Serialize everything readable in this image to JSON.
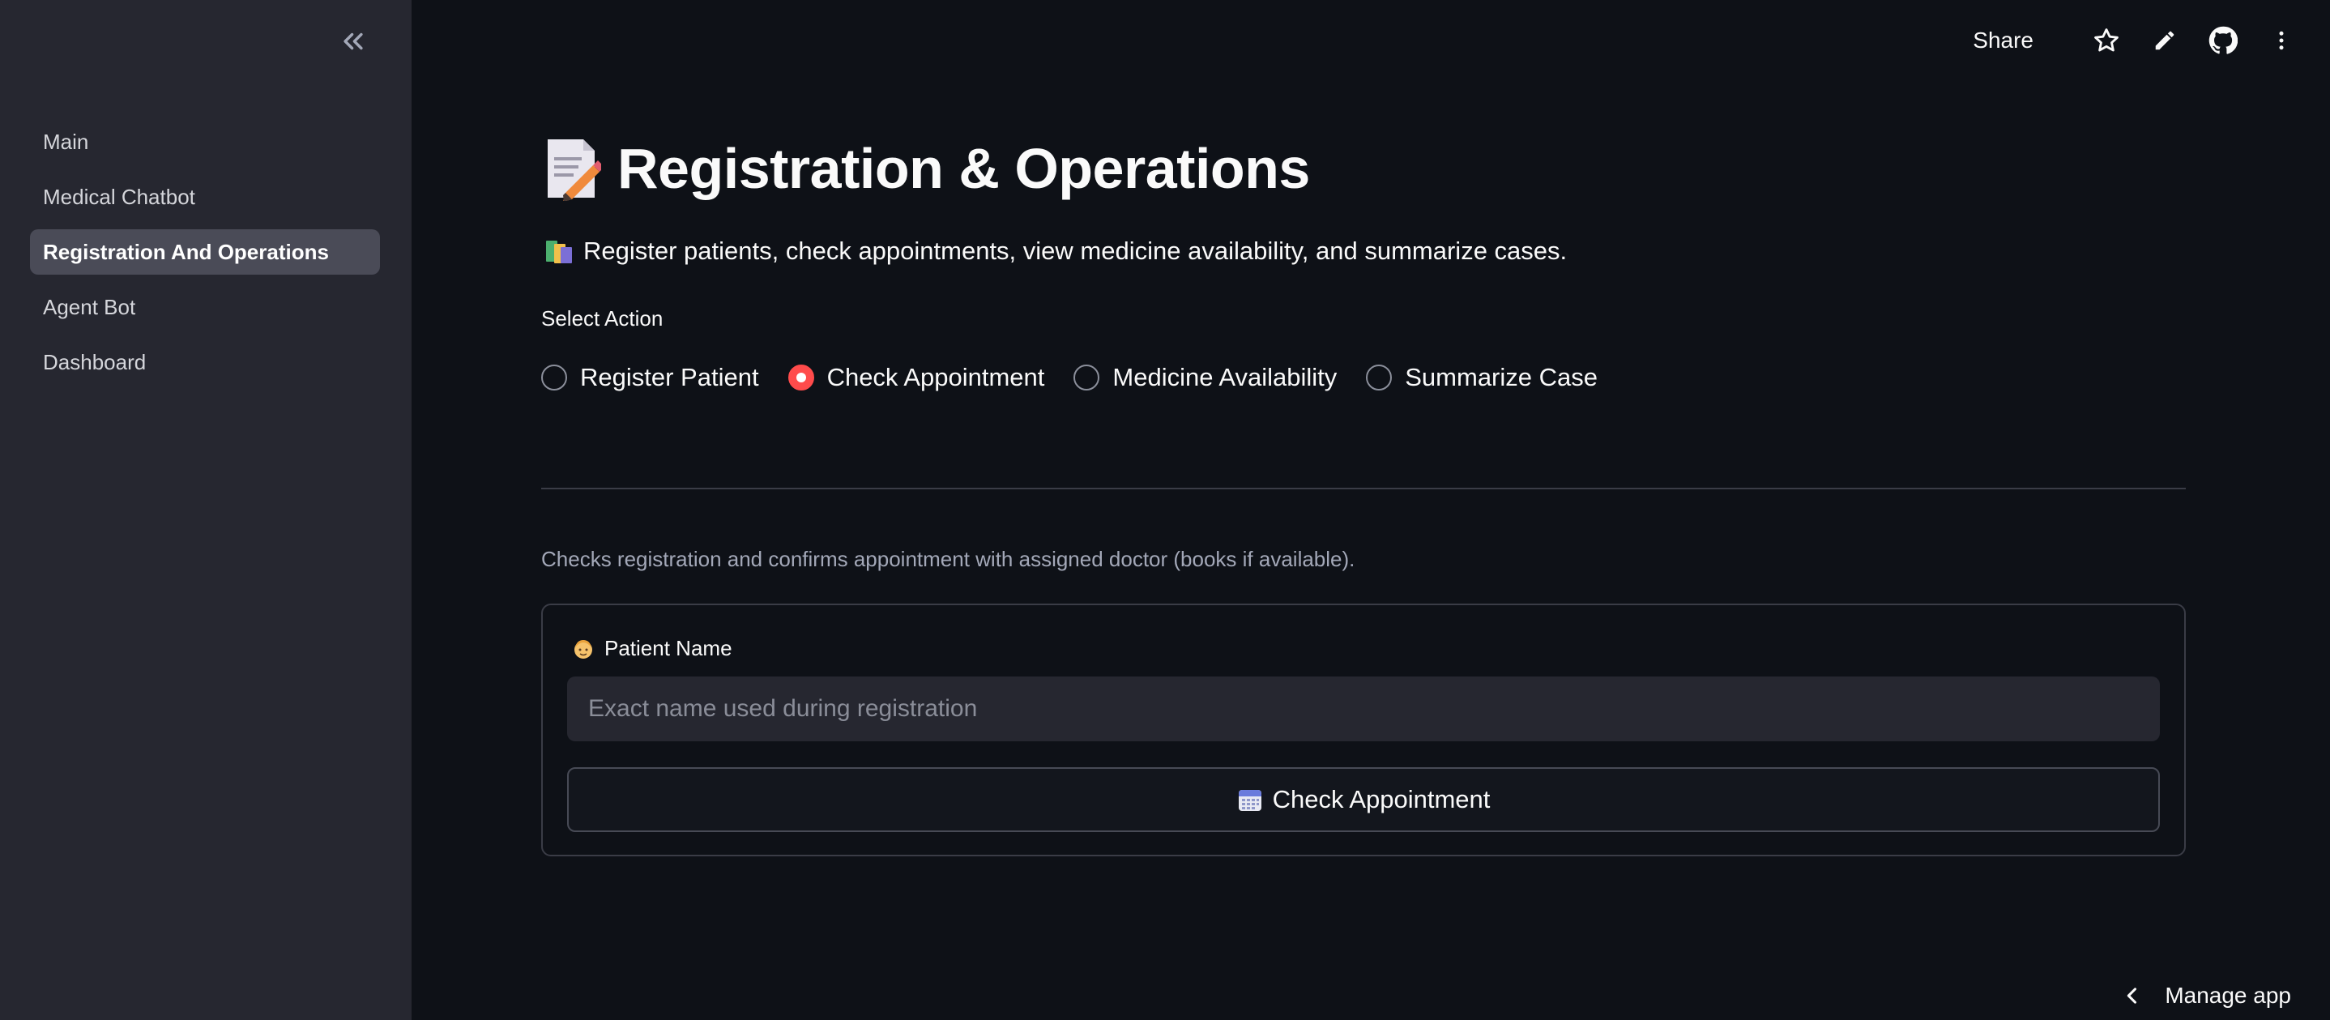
{
  "sidebar": {
    "items": [
      {
        "label": "Main"
      },
      {
        "label": "Medical Chatbot"
      },
      {
        "label": "Registration And Operations",
        "active": true
      },
      {
        "label": "Agent Bot"
      },
      {
        "label": "Dashboard"
      }
    ]
  },
  "toolbar": {
    "share_label": "Share",
    "icons": [
      "star-icon",
      "pencil-icon",
      "github-icon",
      "kebab-menu-icon"
    ]
  },
  "main": {
    "title": "Registration & Operations",
    "subtitle": "Register patients, check appointments, view medicine availability, and summarize cases.",
    "select_label": "Select Action",
    "radio_options": [
      {
        "label": "Register Patient"
      },
      {
        "label": "Check Appointment",
        "selected": true
      },
      {
        "label": "Medicine Availability"
      },
      {
        "label": "Summarize Case"
      }
    ],
    "caption": "Checks registration and confirms appointment with assigned doctor (books if available).",
    "form": {
      "field_label": "Patient Name",
      "field_value": "",
      "field_placeholder": "Exact name used during registration",
      "button_label": "Check Appointment"
    }
  },
  "footer": {
    "manage_label": "Manage app"
  },
  "colors": {
    "accent": "#ff4b4b",
    "background": "#0e1117",
    "sidebar": "#262730"
  }
}
